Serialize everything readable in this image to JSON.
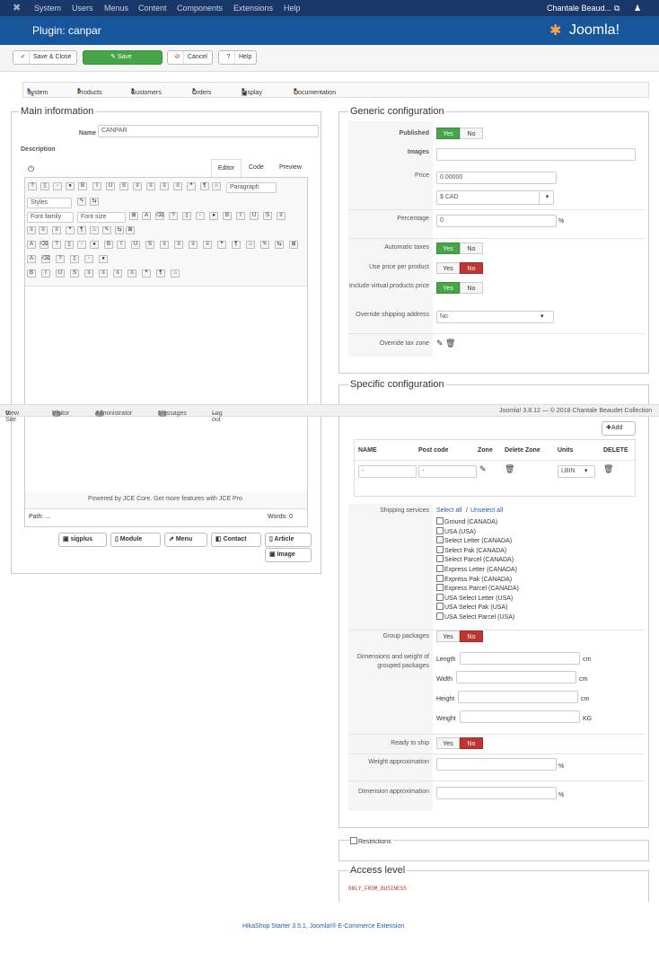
{
  "topnav": {
    "items": [
      "System",
      "Users",
      "Menus",
      "Content",
      "Components",
      "Extensions",
      "Help"
    ],
    "user": "Chantale Beaud..."
  },
  "header": {
    "title": "Plugin: canpar",
    "brand": "Joomla!"
  },
  "toolbar": {
    "save_close": "Save & Close",
    "save": "Save",
    "cancel": "Cancel",
    "help": "Help"
  },
  "menu": {
    "items": [
      "System",
      "Products",
      "Customers",
      "Orders",
      "Display",
      "Documentation"
    ]
  },
  "main": {
    "legend": "Main information",
    "name_label": "Name",
    "name_value": "CANPAR",
    "description_label": "Description",
    "editor_tabs": [
      "Editor",
      "Code",
      "Preview"
    ],
    "paragraph": "Paragraph",
    "styles": "Styles",
    "font_family": "Font family",
    "font_size": "Font size",
    "footer": "Powered by JCE Core. Get more features with JCE Pro",
    "path": "Path: ...",
    "words": "Words: 0",
    "buttons": [
      "sigplus",
      "Module",
      "Menu",
      "Contact",
      "Article",
      "Image"
    ]
  },
  "generic": {
    "legend": "Generic configuration",
    "published": "Published",
    "images": "Images",
    "price": "Price",
    "price_value": "0.00000",
    "currency": "$ CAD",
    "percentage": "Percentage",
    "percentage_value": "0",
    "pct": "%",
    "automatic_taxes": "Automatic taxes",
    "use_price_per_product": "Use price per product",
    "include_virtual": "Include virtual products price",
    "override_shipping": "Override shipping address",
    "override_shipping_value": "No",
    "override_taxzone": "Override tax zone",
    "yes": "Yes",
    "no": "No"
  },
  "statusbar": {
    "view_site": "View Site",
    "visitor_count": "1",
    "visitor": "Visitor",
    "admin_count": "1",
    "administrator": "Administrator",
    "messages_count": "0",
    "messages": "Messages",
    "logout": "Log out",
    "version": "Joomla! 3.8.12 — © 2018 Chantale Beaudet Collection"
  },
  "specific": {
    "legend": "Specific configuration",
    "add": "Add",
    "columns": [
      "NAME",
      "Post code",
      "Zone",
      "Delete Zone",
      "Units",
      "DELETE"
    ],
    "row": {
      "name": "-",
      "post_code": "-",
      "units": "LBIN"
    },
    "shipping_services": "Shipping services",
    "select_all": "Select all",
    "unselect_all": "Unselect all",
    "slash": "/",
    "services": [
      "Ground (CANADA)",
      "USA (USA)",
      "Select Letter (CANADA)",
      "Select Pak (CANADA)",
      "Select Parcel (CANADA)",
      "Express Letter (CANADA)",
      "Express Pak (CANADA)",
      "Express Parcel (CANADA)",
      "USA Select Letter (USA)",
      "USA Select Pak (USA)",
      "USA Select Parcel (USA)"
    ],
    "group_packages": "Group packages",
    "dims_label": "Dimensions and weight of grouped packages",
    "length": "Length",
    "width": "Width",
    "height": "Height",
    "weight": "Weight",
    "cm": "cm",
    "kg": "KG",
    "ready_to_ship": "Ready to ship",
    "weight_approx": "Weight approximation",
    "dimension_approx": "Dimension approximation"
  },
  "restrictions": {
    "label": "Restrictions"
  },
  "access": {
    "legend": "Access level",
    "value": "ONLY_FROM_BUSINESS"
  },
  "footer": {
    "text": "HikaShop Starter 3.5.1, Joomla!® E-Commerce Extension"
  }
}
